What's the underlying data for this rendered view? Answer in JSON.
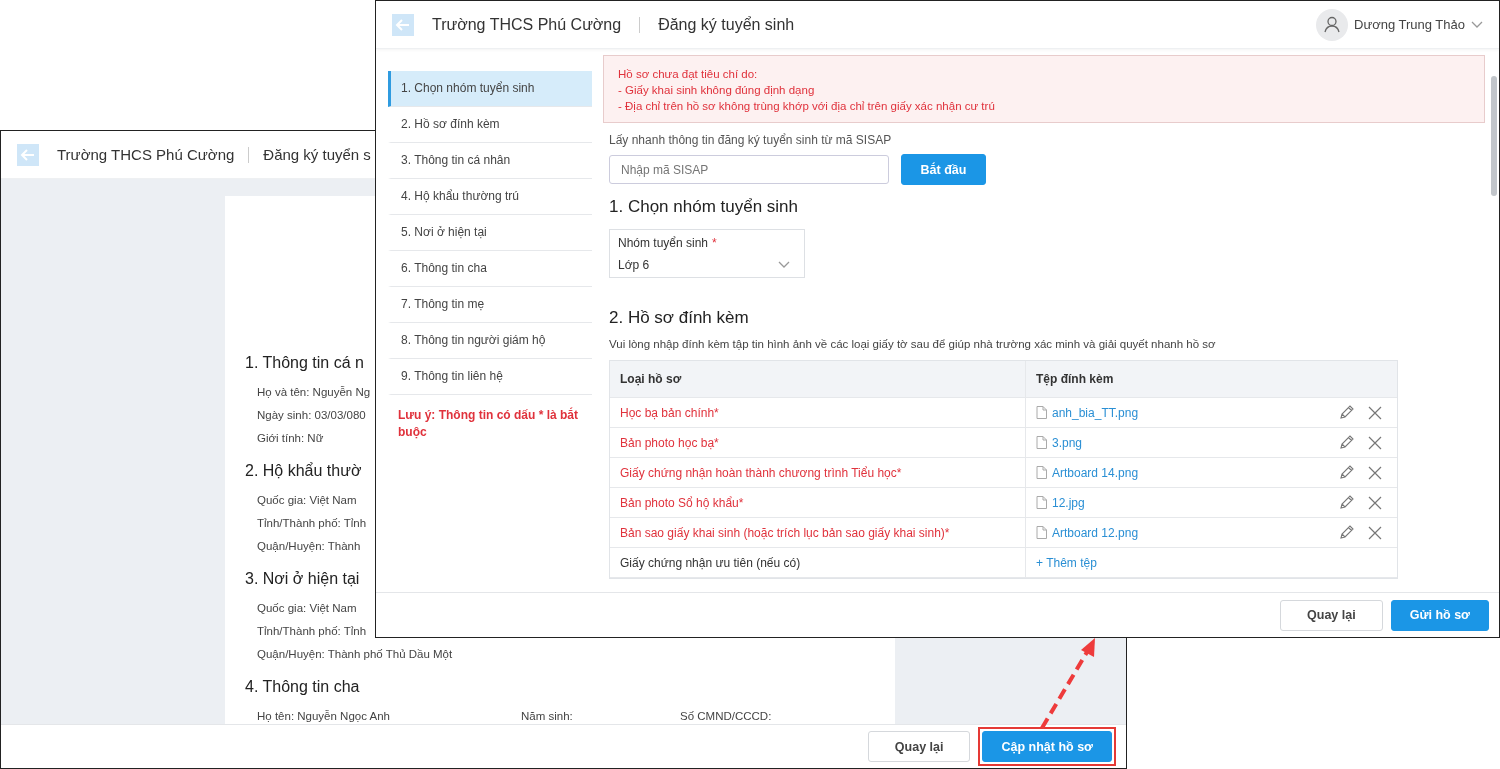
{
  "back_window": {
    "header": {
      "school": "Trường THCS Phú Cường",
      "page": "Đăng ký tuyển s"
    },
    "sections": [
      {
        "heading": "1. Thông tin cá n",
        "lines": [
          [
            "Họ và tên: Nguyễn Ng"
          ],
          [
            "Ngày sinh: 03/03/080"
          ],
          [
            "Giới tính: Nữ"
          ]
        ]
      },
      {
        "heading": "2. Hộ khẩu thườ",
        "lines": [
          [
            "Quốc gia: Việt Nam"
          ],
          [
            "Tỉnh/Thành phố: Tỉnh"
          ],
          [
            "Quận/Huyện: Thành"
          ]
        ]
      },
      {
        "heading": "3. Nơi ở hiện tại",
        "lines": [
          [
            "Quốc gia: Việt Nam"
          ],
          [
            "Tỉnh/Thành phố: Tỉnh"
          ],
          [
            "Quận/Huyện: Thành phố Thủ Dầu Một"
          ]
        ]
      },
      {
        "heading": "4. Thông tin cha",
        "lines": [
          [
            "Họ tên: Nguyễn Ngọc Anh",
            "Năm sinh:",
            "Số CMND/CCCD:"
          ]
        ]
      }
    ],
    "buttons": [
      {
        "label": "Quay lại",
        "kind": "secondary",
        "highlighted": false
      },
      {
        "label": "Cập nhật hồ sơ",
        "kind": "primary",
        "highlighted": true
      }
    ]
  },
  "front_window": {
    "header": {
      "school": "Trường THCS Phú Cường",
      "page": "Đăng ký tuyển sinh",
      "user": "Dương Trung Thảo"
    },
    "sidebar": {
      "items": [
        {
          "label": "1. Chọn nhóm tuyển sinh",
          "selected": true
        },
        {
          "label": "2. Hồ sơ đính kèm",
          "selected": false
        },
        {
          "label": "3. Thông tin cá nhân",
          "selected": false
        },
        {
          "label": "4. Hộ khẩu thường trú",
          "selected": false
        },
        {
          "label": "5. Nơi ở hiện tại",
          "selected": false
        },
        {
          "label": "6. Thông tin cha",
          "selected": false
        },
        {
          "label": "7. Thông tin mẹ",
          "selected": false
        },
        {
          "label": "8. Thông tin người giám hộ",
          "selected": false
        },
        {
          "label": "9. Thông tin liên hệ",
          "selected": false
        }
      ],
      "note": "Lưu ý: Thông tin có dấu * là bắt buộc"
    },
    "alert": {
      "lines": [
        "Hồ sơ chưa đạt tiêu chí do:",
        "- Giấy khai sinh không đúng định dạng",
        "- Địa chỉ trên hồ sơ không trùng khớp với địa chỉ trên giấy xác nhận cư trú"
      ]
    },
    "sisap": {
      "label": "Lấy nhanh thông tin đăng ký tuyển sinh từ mã SISAP",
      "placeholder": "Nhập mã SISAP",
      "button": "Bắt đầu"
    },
    "section1": {
      "heading": "1. Chọn nhóm tuyển sinh",
      "field": {
        "label": "Nhóm tuyển sinh",
        "required_mark": "*",
        "value": "Lớp 6"
      }
    },
    "section2": {
      "heading": "2. Hồ sơ đính kèm",
      "description": "Vui lòng nhập đính kèm tập tin hình ảnh về các loại giấy tờ sau để giúp nhà trường xác minh và giải quyết nhanh hồ sơ",
      "table": {
        "columns": [
          "Loại hồ sơ",
          "Tệp đính kèm"
        ],
        "rows": [
          {
            "document": "Học bạ bản chính*",
            "required": true,
            "kind": "file",
            "file": "anh_bia_TT.png"
          },
          {
            "document": "Bản photo học bạ*",
            "required": true,
            "kind": "file",
            "file": "3.png"
          },
          {
            "document": "Giấy chứng nhận hoàn thành chương trình Tiểu học*",
            "required": true,
            "kind": "file",
            "file": "Artboard 14.png"
          },
          {
            "document": "Bản photo Sổ hộ khẩu*",
            "required": true,
            "kind": "file",
            "file": "12.jpg"
          },
          {
            "document": "Bản sao giấy khai sinh (hoặc trích lục bản sao giấy khai sinh)*",
            "required": true,
            "kind": "file",
            "file": "Artboard 12.png"
          },
          {
            "document": "Giấy chứng nhận ưu tiên (nếu có)",
            "required": false,
            "kind": "add",
            "file": "+ Thêm tệp"
          }
        ]
      }
    },
    "buttons": [
      {
        "label": "Quay lại",
        "kind": "secondary"
      },
      {
        "label": "Gửi hồ sơ",
        "kind": "primary"
      }
    ]
  }
}
